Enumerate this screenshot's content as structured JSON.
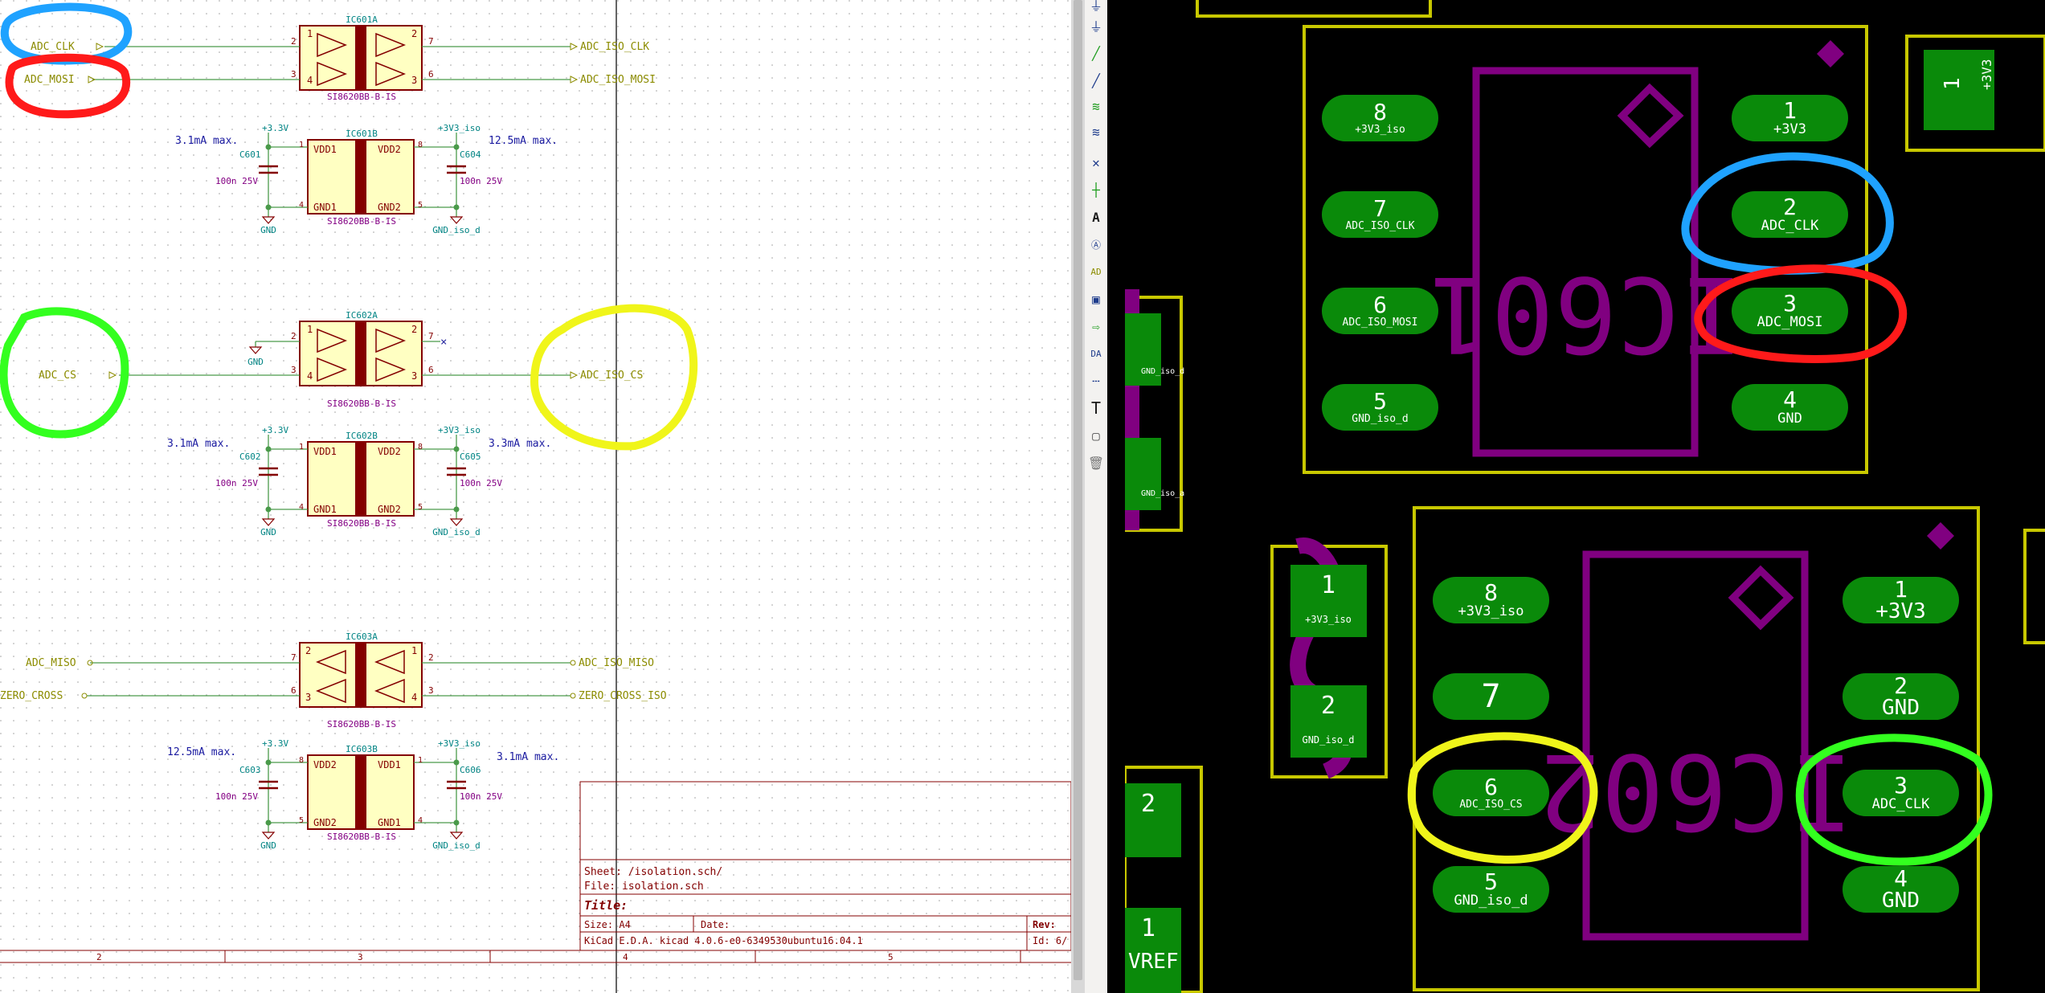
{
  "schematic": {
    "nets_left": {
      "adc_clk": "ADC_CLK",
      "adc_mosi": "ADC_MOSI",
      "adc_cs": "ADC_CS",
      "adc_miso": "ADC_MISO",
      "zero_cross": "ZERO_CROSS"
    },
    "nets_right": {
      "adc_iso_clk": "ADC_ISO_CLK",
      "adc_iso_mosi": "ADC_ISO_MOSI",
      "adc_iso_cs": "ADC_ISO_CS",
      "adc_iso_miso": "ADC_ISO_MISO",
      "zero_cross_iso": "ZERO_CROSS_ISO"
    },
    "ic601a": {
      "ref": "IC601A",
      "value": "SI8620BB-B-IS"
    },
    "ic601b": {
      "ref": "IC601B",
      "value": "SI8620BB-B-IS"
    },
    "ic602a": {
      "ref": "IC602A",
      "value": "SI8620BB-B-IS"
    },
    "ic602b": {
      "ref": "IC602B",
      "value": "SI8620BB-B-IS"
    },
    "ic603a": {
      "ref": "IC603A",
      "value": "SI8620BB-B-IS"
    },
    "ic603b": {
      "ref": "IC603B",
      "value": "SI8620BB-B-IS"
    },
    "pins": {
      "vdd1": "VDD1",
      "vdd2": "VDD2",
      "gnd1": "GND1",
      "gnd2": "GND2",
      "p1": "1",
      "p2": "2",
      "p3": "3",
      "p4": "4",
      "p5": "5",
      "p6": "6",
      "p7": "7",
      "p8": "8"
    },
    "power": {
      "v33": "+3.3V",
      "v33iso": "+3V3_iso",
      "gnd": "GND",
      "gnd_iso": "GND_iso_d",
      "gnd_small": "GND"
    },
    "caps": {
      "c601": "C601",
      "c602": "C602",
      "c603": "C603",
      "c604": "C604",
      "c605": "C605",
      "c606": "C606",
      "value": "100n 25V"
    },
    "currents": {
      "a31": "3.1mA max.",
      "a125": "12.5mA max.",
      "a33": "3.3mA max."
    },
    "title_block": {
      "sheet": "Sheet: /isolation.sch/",
      "file": "File: isolation.sch",
      "title": "Title:",
      "size": "Size: A4",
      "date": "Date:",
      "rev": "Rev:",
      "kicad": "KiCad E.D.A.  kicad 4.0.6-e0-6349530ubuntu16.04.1",
      "id": "Id: 6/"
    },
    "frame_numbers": [
      "2",
      "3",
      "4",
      "5"
    ]
  },
  "pcb": {
    "ic601": {
      "ref": "IC601",
      "pads_left": [
        {
          "num": "8",
          "net": "+3V3_iso"
        },
        {
          "num": "7",
          "net": "ADC_ISO_CLK"
        },
        {
          "num": "6",
          "net": "ADC_ISO_MOSI"
        },
        {
          "num": "5",
          "net": "GND_iso_d"
        }
      ],
      "pads_right": [
        {
          "num": "1",
          "net": "+3V3"
        },
        {
          "num": "2",
          "net": "ADC_CLK"
        },
        {
          "num": "3",
          "net": "ADC_MOSI"
        },
        {
          "num": "4",
          "net": "GND"
        }
      ]
    },
    "ic602": {
      "ref": "IC602",
      "pads_left": [
        {
          "num": "8",
          "net": "+3V3_iso"
        },
        {
          "num": "7",
          "net": ""
        },
        {
          "num": "6",
          "net": "ADC_ISO_CS"
        },
        {
          "num": "5",
          "net": "GND_iso_d"
        }
      ],
      "pads_right": [
        {
          "num": "1",
          "net": "+3V3"
        },
        {
          "num": "2",
          "net": "GND"
        },
        {
          "num": "3",
          "net": "ADC_CLK"
        },
        {
          "num": "4",
          "net": "GND"
        }
      ]
    },
    "conn": {
      "pad1": {
        "num": "1",
        "net": "+3V3_iso"
      },
      "pad2": {
        "num": "2",
        "net": "GND_iso_d"
      }
    },
    "topright": {
      "num": "1",
      "net": "+3V3"
    },
    "left_partials": {
      "n2": "2",
      "n1": "1",
      "vref": "VREF",
      "gnd_d": "GND_iso_d",
      "gnd_a": "GND_iso_a"
    }
  },
  "colors": {
    "net_label": "#8c8c00",
    "wire": "#4a9a4a",
    "part_border": "#840000",
    "part_fill": "#ffffc2",
    "ref_text": "#008484",
    "value_text": "#840084",
    "pad": "#0a8a0a",
    "silk_ref": "#800080",
    "courtyard": "#c8c800",
    "annot_blue": "#1fa2ff",
    "annot_red": "#ff1a1a",
    "annot_green": "#33ff1f",
    "annot_yellow": "#f0f51a"
  }
}
